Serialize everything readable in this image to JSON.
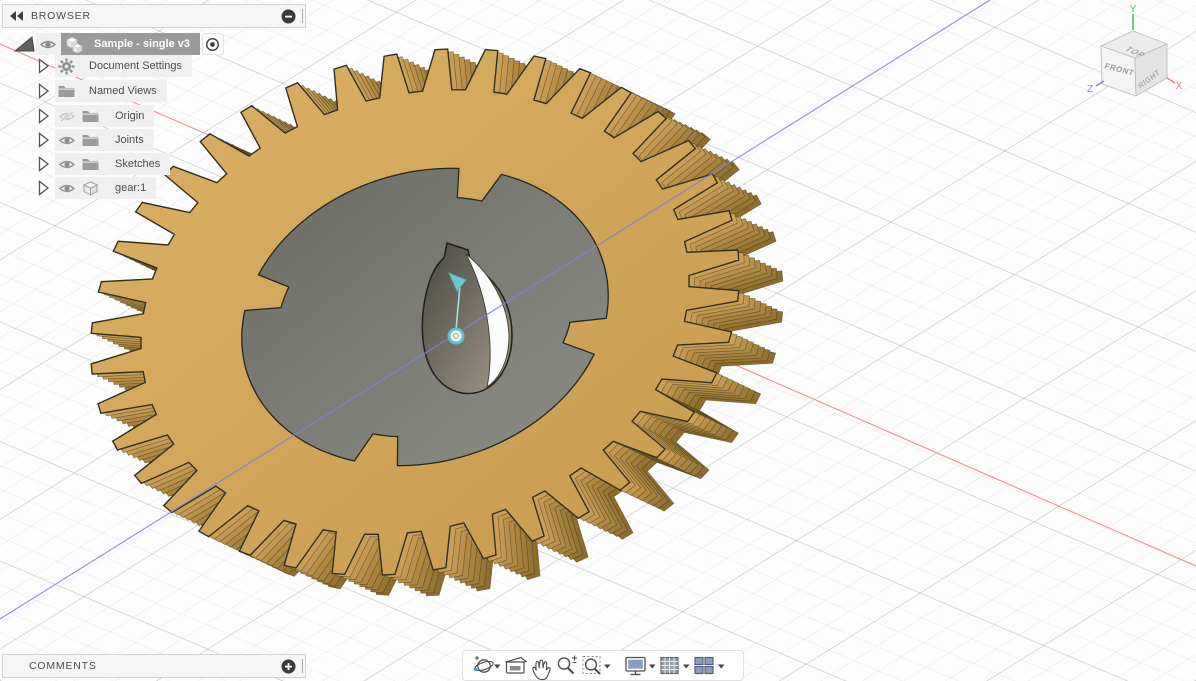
{
  "browser": {
    "title": "BROWSER",
    "collapse_icon": "double-left-arrows",
    "minimize_icon": "minus-circle",
    "root": {
      "label": "Sample - single v3",
      "selected": true,
      "visible": true,
      "activate_control": "radio-selected"
    },
    "items": [
      {
        "label": "Document Settings",
        "icon": "gear-icon",
        "eye": "none"
      },
      {
        "label": "Named Views",
        "icon": "folder-icon",
        "eye": "none"
      },
      {
        "label": "Origin",
        "icon": "folder-icon",
        "eye": "hidden"
      },
      {
        "label": "Joints",
        "icon": "folder-icon",
        "eye": "visible"
      },
      {
        "label": "Sketches",
        "icon": "folder-icon",
        "eye": "visible"
      },
      {
        "label": "gear:1",
        "icon": "body-cube-icon",
        "eye": "visible"
      }
    ]
  },
  "comments": {
    "title": "COMMENTS",
    "add_icon": "plus-circle"
  },
  "navbar": {
    "tools": [
      {
        "name": "orbit",
        "icon": "orbit-icon",
        "has_dropdown": true
      },
      {
        "name": "look-at",
        "icon": "look-at-icon",
        "has_dropdown": false
      },
      {
        "name": "pan",
        "icon": "pan-hand-icon",
        "has_dropdown": false
      },
      {
        "name": "zoom",
        "icon": "zoom-magnifier-icon",
        "has_dropdown": false
      },
      {
        "name": "fit",
        "icon": "fit-magnifier-icon",
        "has_dropdown": true
      },
      {
        "name": "display-settings",
        "icon": "display-icon",
        "has_dropdown": true
      },
      {
        "name": "grid-and-snaps",
        "icon": "grid-icon",
        "has_dropdown": true
      },
      {
        "name": "viewports",
        "icon": "viewports-icon",
        "has_dropdown": true
      }
    ]
  },
  "viewcube": {
    "faces": [
      "TOP",
      "FRONT",
      "RIGHT"
    ],
    "axes": [
      {
        "label": "X",
        "color": "#e87d7d"
      },
      {
        "label": "Y",
        "color": "#4fc24f"
      },
      {
        "label": "Z",
        "color": "#8585e8"
      }
    ]
  },
  "viewport": {
    "object": "spur gear body (gear:1)",
    "gear": {
      "teeth": 40,
      "face_color": "#d2a75e",
      "side_dark_color": "#8e6d2c",
      "pocket_dark": "#6b6c66",
      "pocket_light": "#8c8d86",
      "bore_dark": "#474741",
      "bore_light": "#a39a8a",
      "outline_color": "#32301f"
    },
    "marker_color": "#5fc3c9",
    "axis_x_color": "#f09090",
    "axis_z_color": "#8080e0"
  }
}
